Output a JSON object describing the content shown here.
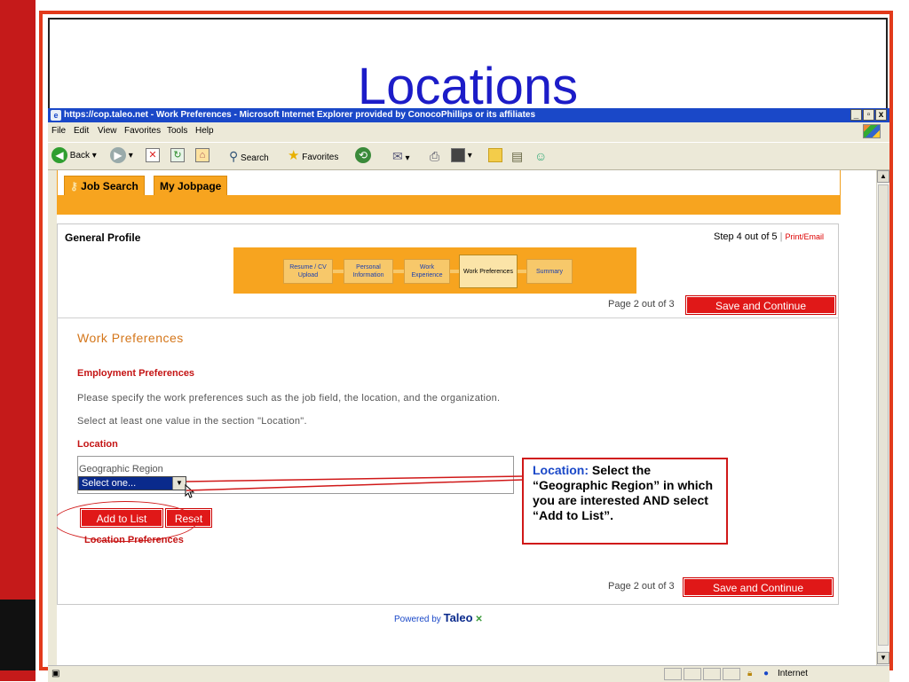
{
  "slide": {
    "title": "Locations"
  },
  "window": {
    "title": "https://cop.taleo.net - Work Preferences - Microsoft Internet Explorer provided by ConocoPhillips or its affiliates",
    "controls": {
      "minimize": "_",
      "maximize": "▫",
      "close": "x"
    }
  },
  "menu": [
    "File",
    "Edit",
    "View",
    "Favorites",
    "Tools",
    "Help"
  ],
  "toolbar": {
    "back": "Back",
    "search": "Search",
    "favorites": "Favorites"
  },
  "tabs": [
    "Job Search",
    "My Jobpage"
  ],
  "profile": {
    "title": "General Profile",
    "step_text": "Step 4 out of 5",
    "separator": "|",
    "print_email": "Print/Email",
    "steps": [
      "Resume / CV Upload",
      "Personal Information",
      "Work Experience",
      "Work Preferences",
      "Summary"
    ],
    "current_step": "Work Preferences",
    "page_of": "Page 2 out of 3",
    "save_continue": "Save and Continue"
  },
  "work_prefs": {
    "title": "Work Preferences",
    "employment_title": "Employment Preferences",
    "instruction1": "Please specify the work preferences such as the job field, the location, and the organization.",
    "instruction2": "Select at least one value in the section \"Location\".",
    "location_title": "Location",
    "geo_label": "Geographic Region",
    "geo_selected": "Select one...",
    "add_to_list": "Add to List",
    "reset": "Reset",
    "location_prefs_title": "Location Preferences"
  },
  "footer": {
    "powered_by": "Powered by",
    "brand": "Taleo"
  },
  "callout": {
    "lead": "Location:",
    "text": " Select the “Geographic Region” in which you are interested AND select “Add to List”."
  },
  "status": {
    "zone": "Internet"
  },
  "colors": {
    "accent_orange": "#f7a41f",
    "button_red": "#e01818",
    "heading_red": "#c41414",
    "title_blue": "#1c1cc8"
  }
}
